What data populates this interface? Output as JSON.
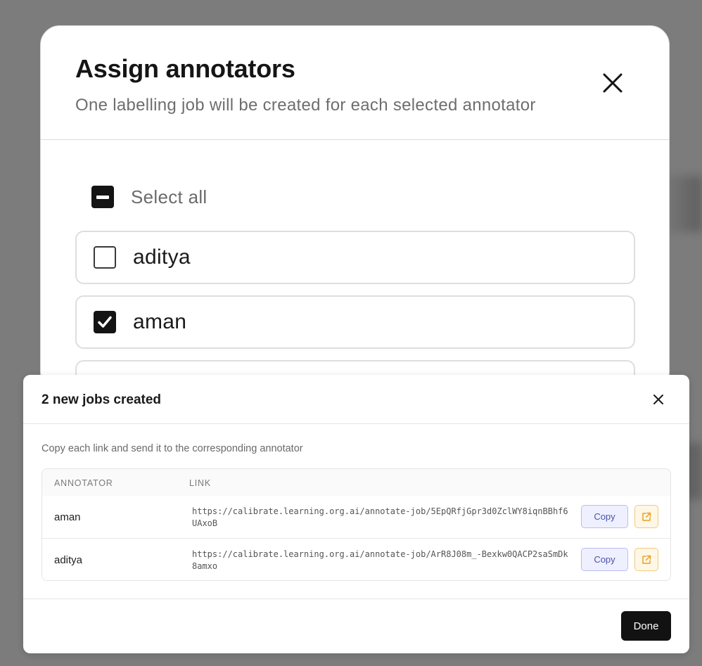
{
  "assign_dialog": {
    "title": "Assign annotators",
    "subtitle": "One labelling job will be created for each selected annotator",
    "select_all_label": "Select all",
    "annotators": [
      {
        "name": "aditya",
        "checked": false
      },
      {
        "name": "aman",
        "checked": true
      }
    ]
  },
  "jobs_dialog": {
    "title": "2 new jobs created",
    "description": "Copy each link and send it to the corresponding annotator",
    "columns": {
      "annotator": "ANNOTATOR",
      "link": "LINK"
    },
    "rows": [
      {
        "annotator": "aman",
        "link": "https://calibrate.learning.org.ai/annotate-job/5EpQRfjGpr3d0ZclWY8iqnBBhf6UAxoB",
        "copy_label": "Copy"
      },
      {
        "annotator": "aditya",
        "link": "https://calibrate.learning.org.ai/annotate-job/ArR8J08m_-Bexkw0QACP2saSmDk8amxo",
        "copy_label": "Copy"
      }
    ],
    "done_label": "Done"
  },
  "colors": {
    "overlay": "#7c7c7c",
    "primary_button": "#121212",
    "copy_button_bg": "#eef0ff",
    "copy_button_text": "#4b51a8",
    "open_button_bg": "#fff7e6",
    "open_button_icon": "#e8a020"
  },
  "icons": {
    "close": "close-icon",
    "checkbox_indeterminate": "checkbox-indeterminate-icon",
    "checkmark": "checkmark-icon",
    "external_link": "external-link-icon"
  }
}
